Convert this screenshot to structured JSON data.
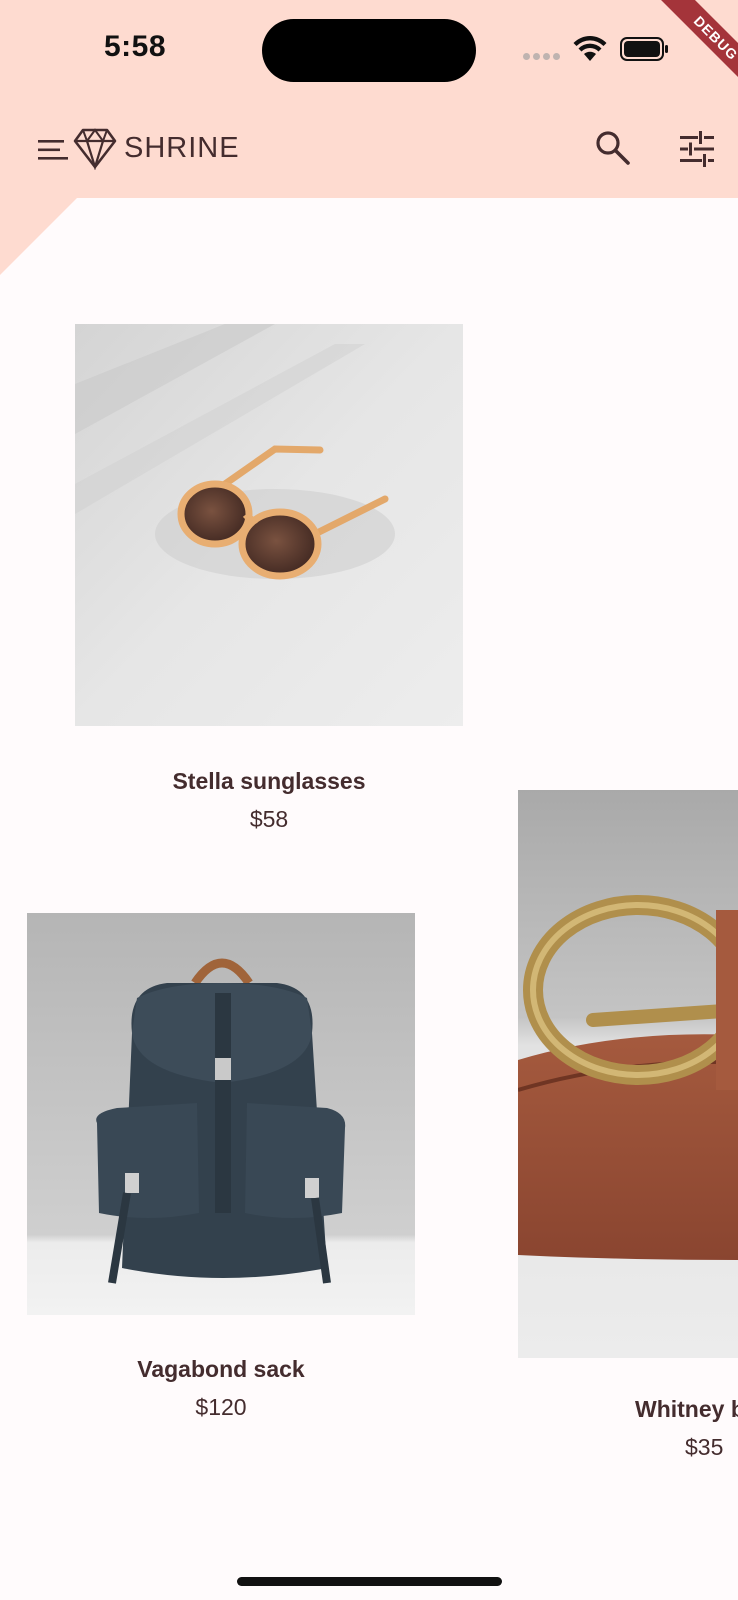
{
  "status_bar": {
    "time": "5:58",
    "debug_label": "DEBUG"
  },
  "app_bar": {
    "brand": "SHRINE",
    "icons": [
      "menu-icon",
      "diamond-logo-icon",
      "search-icon",
      "tune-icon"
    ],
    "background": "#FEDBD0"
  },
  "products": [
    {
      "name": "Stella sunglasses",
      "price": "$58"
    },
    {
      "name": "Vagabond sack",
      "price": "$120"
    },
    {
      "name": "Whitney b",
      "price": "$35"
    }
  ],
  "colors": {
    "accent": "#442C2E",
    "surface": "#FFFBFC",
    "debug": "#A4343A"
  }
}
